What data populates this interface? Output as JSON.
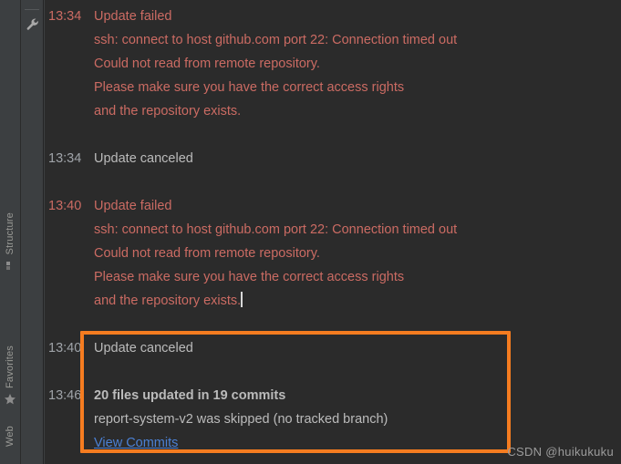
{
  "sidebar": {
    "tabs": [
      {
        "label": "Structure",
        "icon": "structure-icon"
      },
      {
        "label": "Favorites",
        "icon": "star-icon"
      },
      {
        "label": "Web",
        "icon": "web-icon"
      }
    ]
  },
  "gutter": {
    "settings_icon": "wrench-icon"
  },
  "console": {
    "entries": [
      {
        "time": "13:34",
        "title": "Update failed",
        "type": "error",
        "details": [
          "ssh: connect to host github.com port 22: Connection timed out",
          "Could not read from remote repository.",
          "Please make sure you have the correct access rights",
          "and the repository exists."
        ]
      },
      {
        "time": "13:34",
        "title": "Update canceled",
        "type": "neutral",
        "details": []
      },
      {
        "time": "13:40",
        "title": "Update failed",
        "type": "error",
        "details": [
          "ssh: connect to host github.com port 22: Connection timed out",
          "Could not read from remote repository.",
          "Please make sure you have the correct access rights",
          "and the repository exists."
        ]
      },
      {
        "time": "13:40",
        "title": "Update canceled",
        "type": "neutral",
        "details": []
      },
      {
        "time": "13:46",
        "title": "20 files updated in 19 commits",
        "type": "success",
        "details": [
          "report-system-v2 was skipped (no tracked branch)"
        ],
        "link": "View Commits"
      }
    ]
  },
  "annotation": {
    "color": "#f57c20"
  },
  "watermark": {
    "text": "CSDN @huikukuku"
  },
  "colors": {
    "background": "#2b2b2b",
    "panel": "#3c3f41",
    "error_text": "#cb6b63",
    "neutral_text": "#bbbbbb",
    "link": "#4b80d4",
    "highlight": "#f57c20"
  }
}
